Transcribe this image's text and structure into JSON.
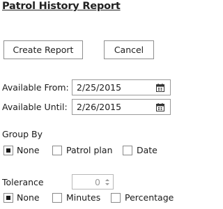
{
  "report": {
    "title": "Patrol History Report"
  },
  "actions": {
    "create_label": "Create Report",
    "cancel_label": "Cancel"
  },
  "availability": {
    "from_label": "Available From:",
    "from_value": "2/25/2015",
    "until_label": "Available Until:",
    "until_value": "2/26/2015",
    "calendar_icon": "calendar-icon"
  },
  "group_by": {
    "label": "Group By",
    "options": [
      {
        "label": "None",
        "checked": true
      },
      {
        "label": "Patrol plan",
        "checked": false
      },
      {
        "label": "Date",
        "checked": false
      }
    ]
  },
  "tolerance": {
    "label": "Tolerance",
    "value": "0",
    "options": [
      {
        "label": "None",
        "checked": true
      },
      {
        "label": "Minutes",
        "checked": false
      },
      {
        "label": "Percentage",
        "checked": false
      }
    ]
  }
}
